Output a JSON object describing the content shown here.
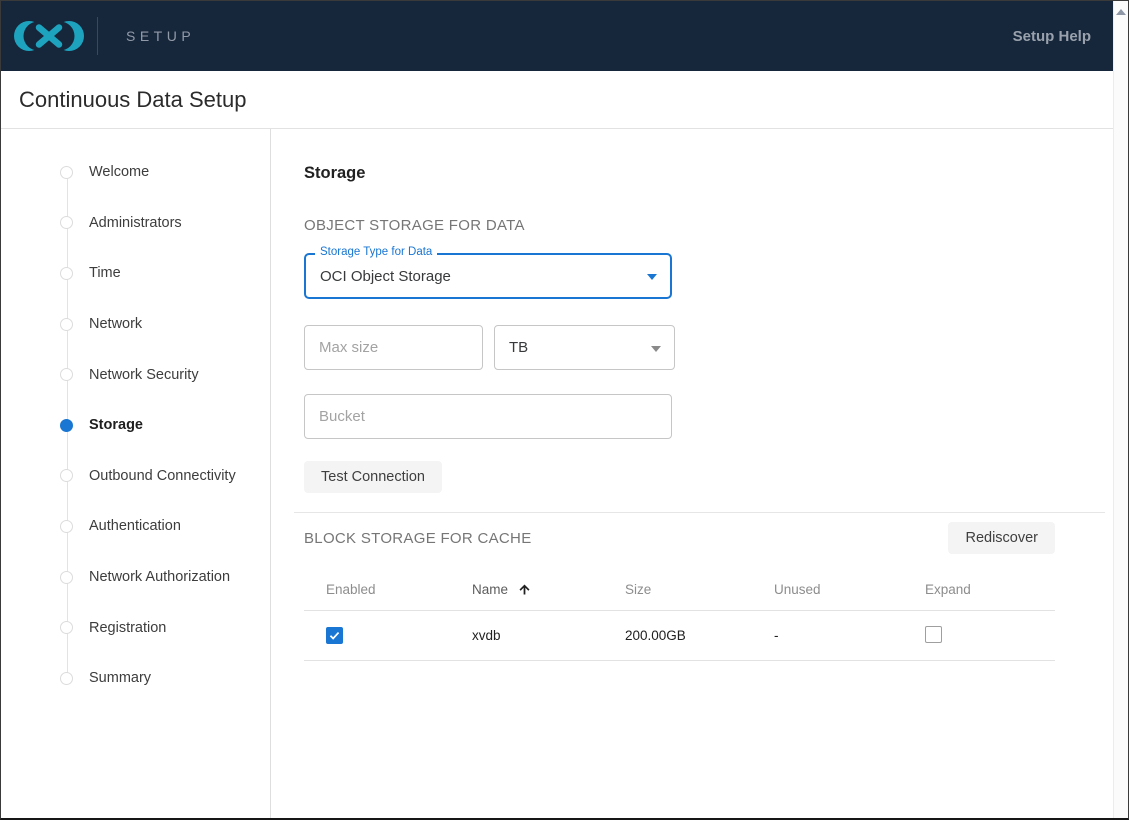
{
  "header": {
    "product": "SETUP",
    "help": "Setup Help"
  },
  "title_bar": {
    "title": "Continuous Data Setup"
  },
  "stepper": {
    "active_step": "Storage",
    "steps": [
      {
        "label": "Welcome"
      },
      {
        "label": "Administrators"
      },
      {
        "label": "Time"
      },
      {
        "label": "Network"
      },
      {
        "label": "Network Security"
      },
      {
        "label": "Storage",
        "active": true
      },
      {
        "label": "Outbound Connectivity"
      },
      {
        "label": "Authentication"
      },
      {
        "label": "Network Authorization"
      },
      {
        "label": "Registration"
      },
      {
        "label": "Summary"
      }
    ]
  },
  "content": {
    "heading": "Storage",
    "object_storage": {
      "section_title": "OBJECT STORAGE FOR DATA",
      "storage_type_label": "Storage Type for Data",
      "storage_type_value": "OCI Object Storage",
      "max_size_placeholder": "Max size",
      "max_size_value": "",
      "unit_value": "TB",
      "bucket_placeholder": "Bucket",
      "bucket_value": "",
      "test_connection_label": "Test Connection"
    },
    "block_storage": {
      "section_title": "BLOCK STORAGE FOR CACHE",
      "rediscover_label": "Rediscover",
      "table": {
        "columns": [
          "Enabled",
          "Name",
          "Size",
          "Unused",
          "Expand"
        ],
        "sorted_by": "Name",
        "sort_direction": "ascending",
        "rows": [
          {
            "enabled": true,
            "name": "xvdb",
            "size": "200.00GB",
            "unused": "-",
            "expand": false
          }
        ]
      }
    }
  },
  "colors": {
    "header_navy": "#16263B",
    "logo_teal": "#1EA3BF",
    "accent_blue": "#1976D2"
  }
}
